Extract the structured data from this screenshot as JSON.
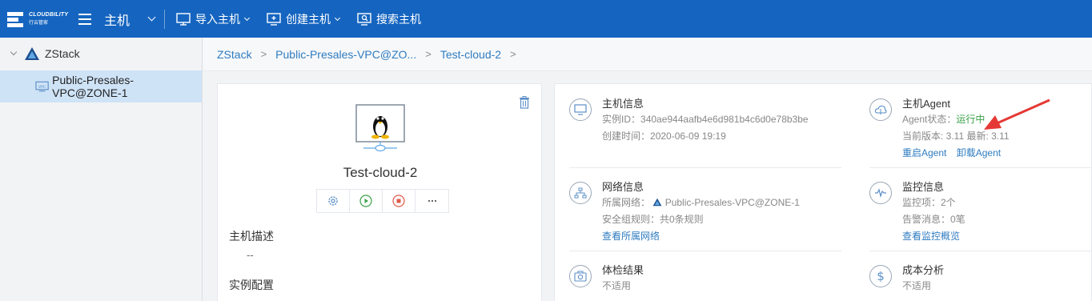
{
  "brand": {
    "line1": "CLOUDBILITY",
    "line2": "行云管家"
  },
  "topbar": {
    "title": "主机",
    "import_label": "导入主机",
    "create_label": "创建主机",
    "search_label": "搜索主机"
  },
  "sidebar": {
    "root": "ZStack",
    "child": "Public-Presales-VPC@ZONE-1"
  },
  "breadcrumb": [
    "ZStack",
    "Public-Presales-VPC@ZO...",
    "Test-cloud-2"
  ],
  "host": {
    "name": "Test-cloud-2",
    "desc_label": "主机描述",
    "desc_value": "--",
    "config_label": "实例配置"
  },
  "info": {
    "host_info": {
      "title": "主机信息",
      "id_label": "实例ID：",
      "id_value": "340ae944aafb4e6d981b4c6d0e78b3be",
      "time_label": "创建时间：",
      "time_value": "2020-06-09 19:19"
    },
    "agent": {
      "title": "主机Agent",
      "status_label": "Agent状态：",
      "status_value": "运行中",
      "version_text": "当前版本: 3.11 最新: 3.11",
      "restart_label": "重启Agent",
      "uninstall_label": "卸载Agent"
    },
    "network": {
      "title": "网络信息",
      "net_label": "所属网络：",
      "net_value": "Public-Presales-VPC@ZONE-1",
      "rules_text": "安全组规则：共0条规则",
      "view_link": "查看所属网络"
    },
    "monitor": {
      "title": "监控信息",
      "items_text": "监控项：2个",
      "alerts_text": "告警消息：0笔",
      "view_link": "查看监控概览"
    },
    "check": {
      "title": "体检结果",
      "value": "不适用"
    },
    "cost": {
      "title": "成本分析",
      "value": "不适用"
    }
  },
  "colors": {
    "topbar": "#1565c0",
    "link": "#2f7cc0",
    "ok": "#3ca24b",
    "arrow": "#e53935",
    "selected": "#cfe3f7"
  }
}
